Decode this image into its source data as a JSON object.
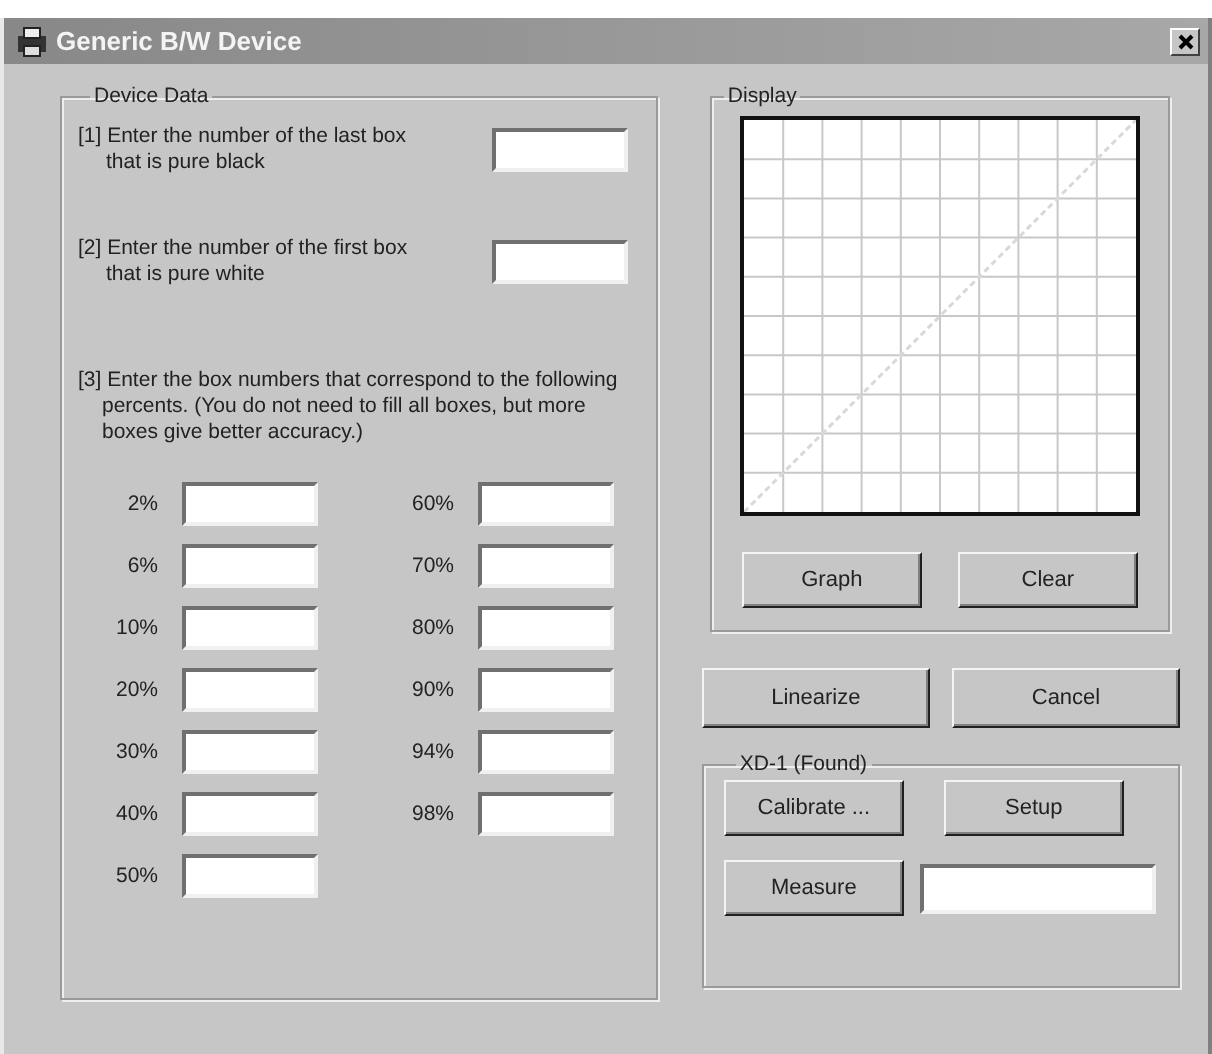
{
  "window": {
    "title": "Generic B/W Device"
  },
  "device_data": {
    "title": "Device Data",
    "steps": [
      {
        "text": "[1] Enter the number of the last box that is pure black"
      },
      {
        "text": "[2] Enter the number of the first box that is pure white"
      }
    ],
    "percent_note": "[3] Enter the box numbers that correspond to the following percents. (You do not need to fill all boxes, but more boxes give better accuracy.)",
    "percent_columns": [
      [
        {
          "label": "2%"
        },
        {
          "label": "6%"
        },
        {
          "label": "10%"
        },
        {
          "label": "20%"
        },
        {
          "label": "30%"
        },
        {
          "label": "40%"
        },
        {
          "label": "50%"
        }
      ],
      [
        {
          "label": "60%"
        },
        {
          "label": "70%"
        },
        {
          "label": "80%"
        },
        {
          "label": "90%"
        },
        {
          "label": "94%"
        },
        {
          "label": "98%"
        }
      ]
    ]
  },
  "display": {
    "title": "Display",
    "buttons": [
      "Graph",
      "Clear"
    ]
  },
  "actions": [
    "Linearize",
    "Cancel"
  ],
  "device": {
    "title": "XD-1 (Found)",
    "buttons": [
      "Calibrate ...",
      "Setup"
    ],
    "measure_button": "Measure"
  }
}
